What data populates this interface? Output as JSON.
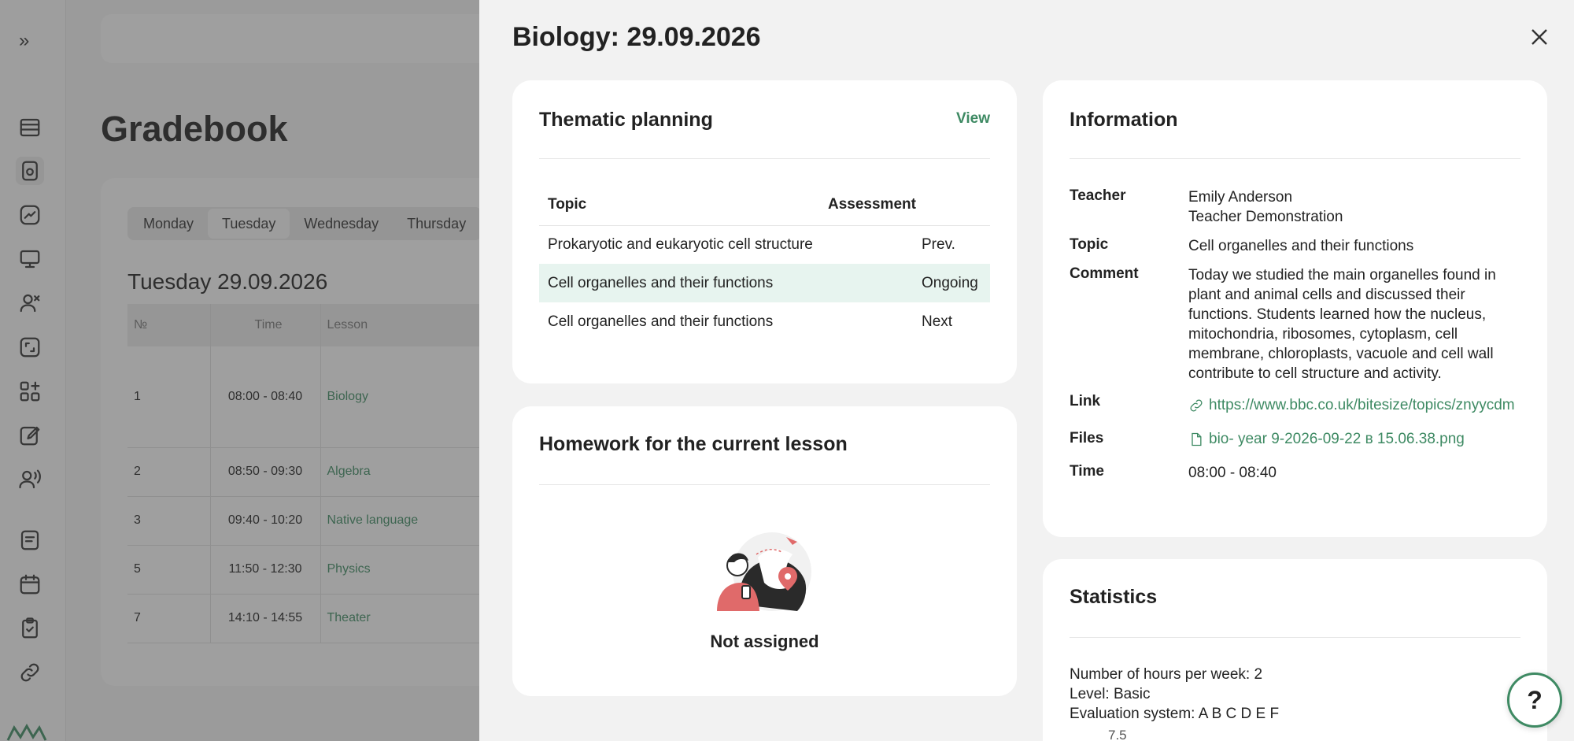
{
  "app": {
    "title": "Gradebook",
    "days": [
      "Monday",
      "Tuesday",
      "Wednesday",
      "Thursday"
    ],
    "active_day": "Tuesday",
    "date_heading": "Tuesday 29.09.2026",
    "schedule_headers": [
      "№",
      "Time",
      "Lesson"
    ],
    "schedule_rows": [
      {
        "num": "1",
        "time": "08:00 - 08:40",
        "lesson": "Biology"
      },
      {
        "num": "2",
        "time": "08:50 - 09:30",
        "lesson": "Algebra"
      },
      {
        "num": "3",
        "time": "09:40 - 10:20",
        "lesson": "Native language"
      },
      {
        "num": "5",
        "time": "11:50 - 12:30",
        "lesson": "Physics"
      },
      {
        "num": "7",
        "time": "14:10 - 14:55",
        "lesson": "Theater"
      }
    ]
  },
  "panel": {
    "title": "Biology: 29.09.2026",
    "thematic": {
      "heading": "Thematic planning",
      "view_label": "View",
      "headers": [
        "Topic",
        "Assessment"
      ],
      "rows": [
        {
          "topic": "Prokaryotic and eukaryotic cell structure",
          "status": "Prev."
        },
        {
          "topic": "Cell organelles and their functions",
          "status": "Ongoing"
        },
        {
          "topic": "Cell organelles and their functions",
          "status": "Next"
        }
      ]
    },
    "homework": {
      "heading": "Homework for the current lesson",
      "empty_text": "Not assigned"
    },
    "information": {
      "heading": "Information",
      "teacher_label": "Teacher",
      "teacher_name": "Emily Anderson",
      "teacher_role": "Teacher Demonstration",
      "topic_label": "Topic",
      "topic": "Cell organelles and their functions",
      "comment_label": "Comment",
      "comment": "Today we studied the main organelles found in plant and animal cells and discussed their functions. Students learned how the nucleus, mitochondria, ribosomes, cytoplasm, cell membrane, chloroplasts, vacuole and cell wall contribute to cell structure and activity.",
      "link_label": "Link",
      "link": "https://www.bbc.co.uk/bitesize/topics/znyycdm",
      "files_label": "Files",
      "file": "bio- year 9-2026-09-22 в 15.06.38.png",
      "time_label": "Time",
      "time": "08:00 - 08:40"
    },
    "statistics": {
      "heading": "Statistics",
      "hours": "Number of hours per week: 2",
      "level": "Level: Basic",
      "evaluation": "Evaluation system: A B C D E F",
      "tick": "7.5"
    },
    "help_label": "?"
  },
  "colors": {
    "accent": "#3e8a63",
    "highlight_row": "#e7f4ef"
  }
}
